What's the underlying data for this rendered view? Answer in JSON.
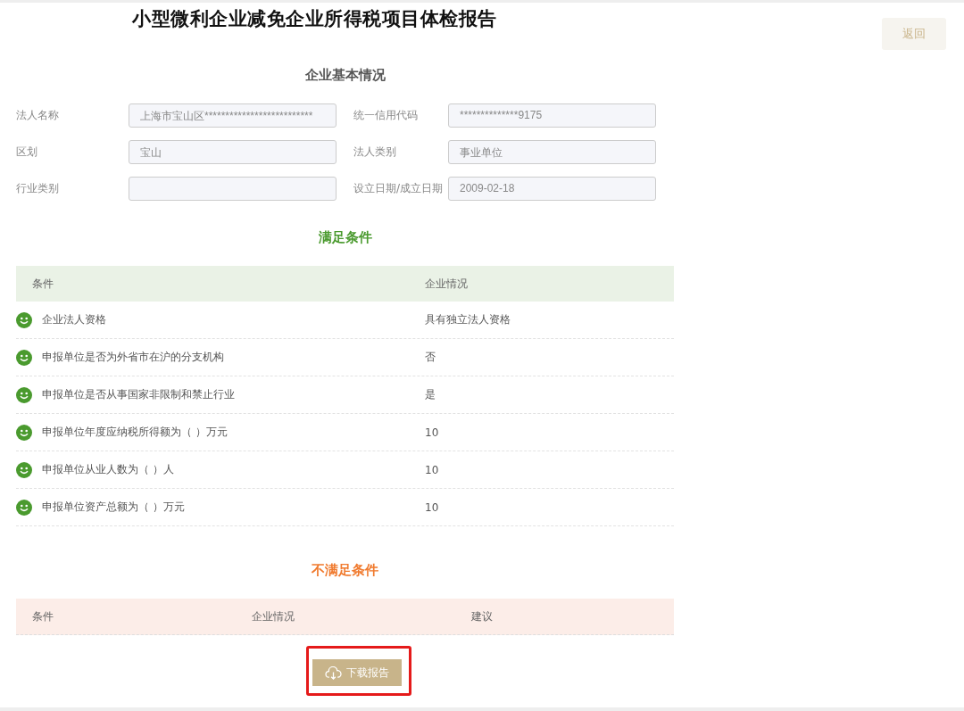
{
  "title": "小型微利企业减免企业所得税项目体检报告",
  "back_button": "返回",
  "basic_info": {
    "heading": "企业基本情况",
    "fields": [
      {
        "label": "法人名称",
        "value": "上海市宝山区**************************"
      },
      {
        "label": "统一信用代码",
        "value": "**************9175"
      },
      {
        "label": "区划",
        "value": "宝山"
      },
      {
        "label": "法人类别",
        "value": "事业单位"
      },
      {
        "label": "行业类别"
      },
      {
        "label": "设立日期/成立日期",
        "value": "2009-02-18"
      }
    ]
  },
  "met": {
    "heading": "满足条件",
    "columns": [
      "条件",
      "企业情况"
    ],
    "rows": [
      {
        "condition": "企业法人资格",
        "status": "具有独立法人资格"
      },
      {
        "condition": "申报单位是否为外省市在沪的分支机构",
        "status": "否"
      },
      {
        "condition": "申报单位是否从事国家非限制和禁止行业",
        "status": "是"
      },
      {
        "condition": "申报单位年度应纳税所得额为（ ）万元",
        "status": "10"
      },
      {
        "condition": "申报单位从业人数为（ ）人",
        "status": "10"
      },
      {
        "condition": "申报单位资产总额为（ ）万元",
        "status": "10"
      }
    ]
  },
  "unmet": {
    "heading": "不满足条件",
    "columns": [
      "条件",
      "企业情况",
      "建议"
    ]
  },
  "download_button": "下载报告"
}
